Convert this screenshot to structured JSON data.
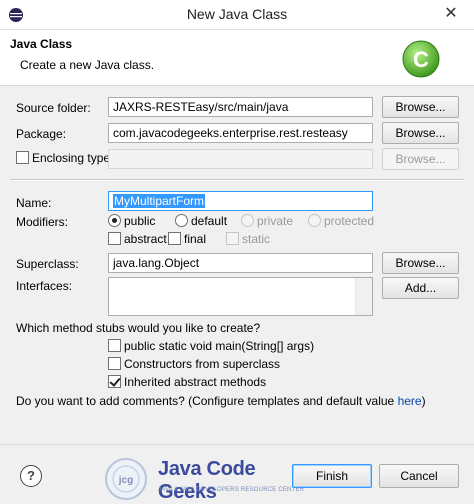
{
  "window": {
    "title": "New Java Class",
    "close_glyph": "✕"
  },
  "header": {
    "title": "Java Class",
    "description": "Create a new Java class."
  },
  "source_folder": {
    "label": "Source folder:",
    "value": "JAXRS-RESTEasy/src/main/java",
    "button": "Browse..."
  },
  "package": {
    "label": "Package:",
    "value": "com.javacodegeeks.enterprise.rest.resteasy",
    "button": "Browse..."
  },
  "enclosing": {
    "label": "Enclosing type:",
    "value": "",
    "button": "Browse...",
    "checked": false
  },
  "name": {
    "label": "Name:",
    "value": "MyMultipartForm"
  },
  "modifiers": {
    "label": "Modifiers:",
    "public": "public",
    "default": "default",
    "private": "private",
    "protected": "protected",
    "abstract": "abstract",
    "final": "final",
    "static": "static"
  },
  "superclass": {
    "label": "Superclass:",
    "value": "java.lang.Object",
    "button": "Browse..."
  },
  "interfaces": {
    "label": "Interfaces:",
    "button": "Add..."
  },
  "stubs": {
    "question": "Which method stubs would you like to create?",
    "main": "public static void main(String[] args)",
    "constructors": "Constructors from superclass",
    "inherited": "Inherited abstract methods"
  },
  "comments": {
    "question_prefix": "Do you want to add comments? (",
    "link": "Configure templates and default value",
    "link2": "here",
    "suffix": ")"
  },
  "footer": {
    "help_glyph": "?",
    "logo_text": "Java Code Geeks",
    "logo_tagline": "JAVA 2 JAVA DEVELOPERS RESOURCE CENTER",
    "finish": "Finish",
    "cancel": "Cancel"
  },
  "colors": {
    "accent": "#3399ff",
    "logo": "#3b4a9c",
    "wizard_icon": "#5ab82e"
  }
}
